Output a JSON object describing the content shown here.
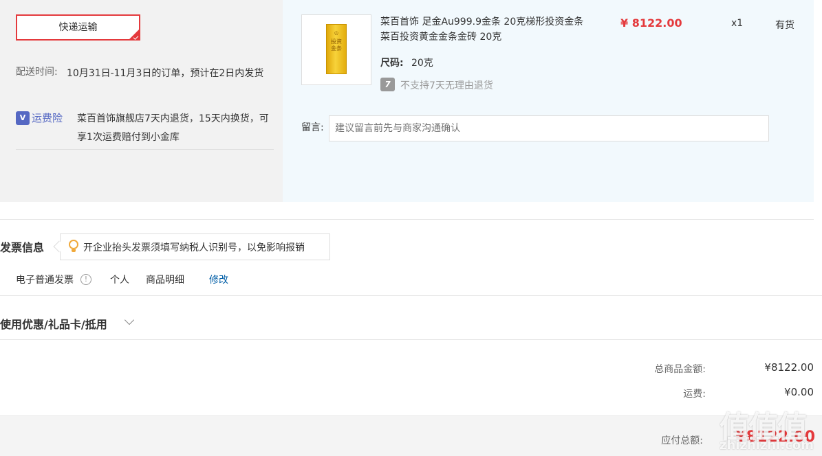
{
  "shipping": {
    "method_label": "快递运输",
    "delivery_label": "配送时间:",
    "delivery_text": "10月31日-11月3日的订单，预计在2日内发货",
    "insurance_icon": "V",
    "insurance_label": "运费险",
    "insurance_text": "菜百首饰旗舰店7天内退货，15天内换货，可享1次运费赔付到小金库"
  },
  "product": {
    "image_mark": "♔",
    "image_text": "投资金条",
    "name": "菜百首饰 足金Au999.9金条 20克梯形投资金条 菜百投资黄金金条金砖 20克",
    "spec_label": "尺码:",
    "spec_value": "20克",
    "no_return_icon": "7",
    "no_return_text": "不支持7天无理由退货",
    "price": "¥ 8122.00",
    "quantity": "x1",
    "stock": "有货"
  },
  "memo": {
    "label": "留言:",
    "placeholder": "建议留言前先与商家沟通确认"
  },
  "invoice": {
    "title": "发票信息",
    "tip": "开企业抬头发票须填写纳税人识别号，以免影响报销",
    "type": "电子普通发票",
    "info_icon": "!",
    "person": "个人",
    "content": "商品明细",
    "edit_label": "修改"
  },
  "coupon": {
    "title": "使用优惠/礼品卡/抵用"
  },
  "summary": {
    "goods_label": "总商品金额:",
    "goods_value": "¥8122.00",
    "shipping_label": "运费:",
    "shipping_value": "¥0.00",
    "pay_label": "应付总额:",
    "pay_value": "¥8122.00"
  },
  "watermark": {
    "logo": "值值值",
    "text": "zhizhizhi.com"
  },
  "colors": {
    "accent_red": "#e4393c",
    "link_blue": "#005ea7",
    "insurance_blue": "#5568c3",
    "goods_panel_bg": "#f2f9fd"
  }
}
